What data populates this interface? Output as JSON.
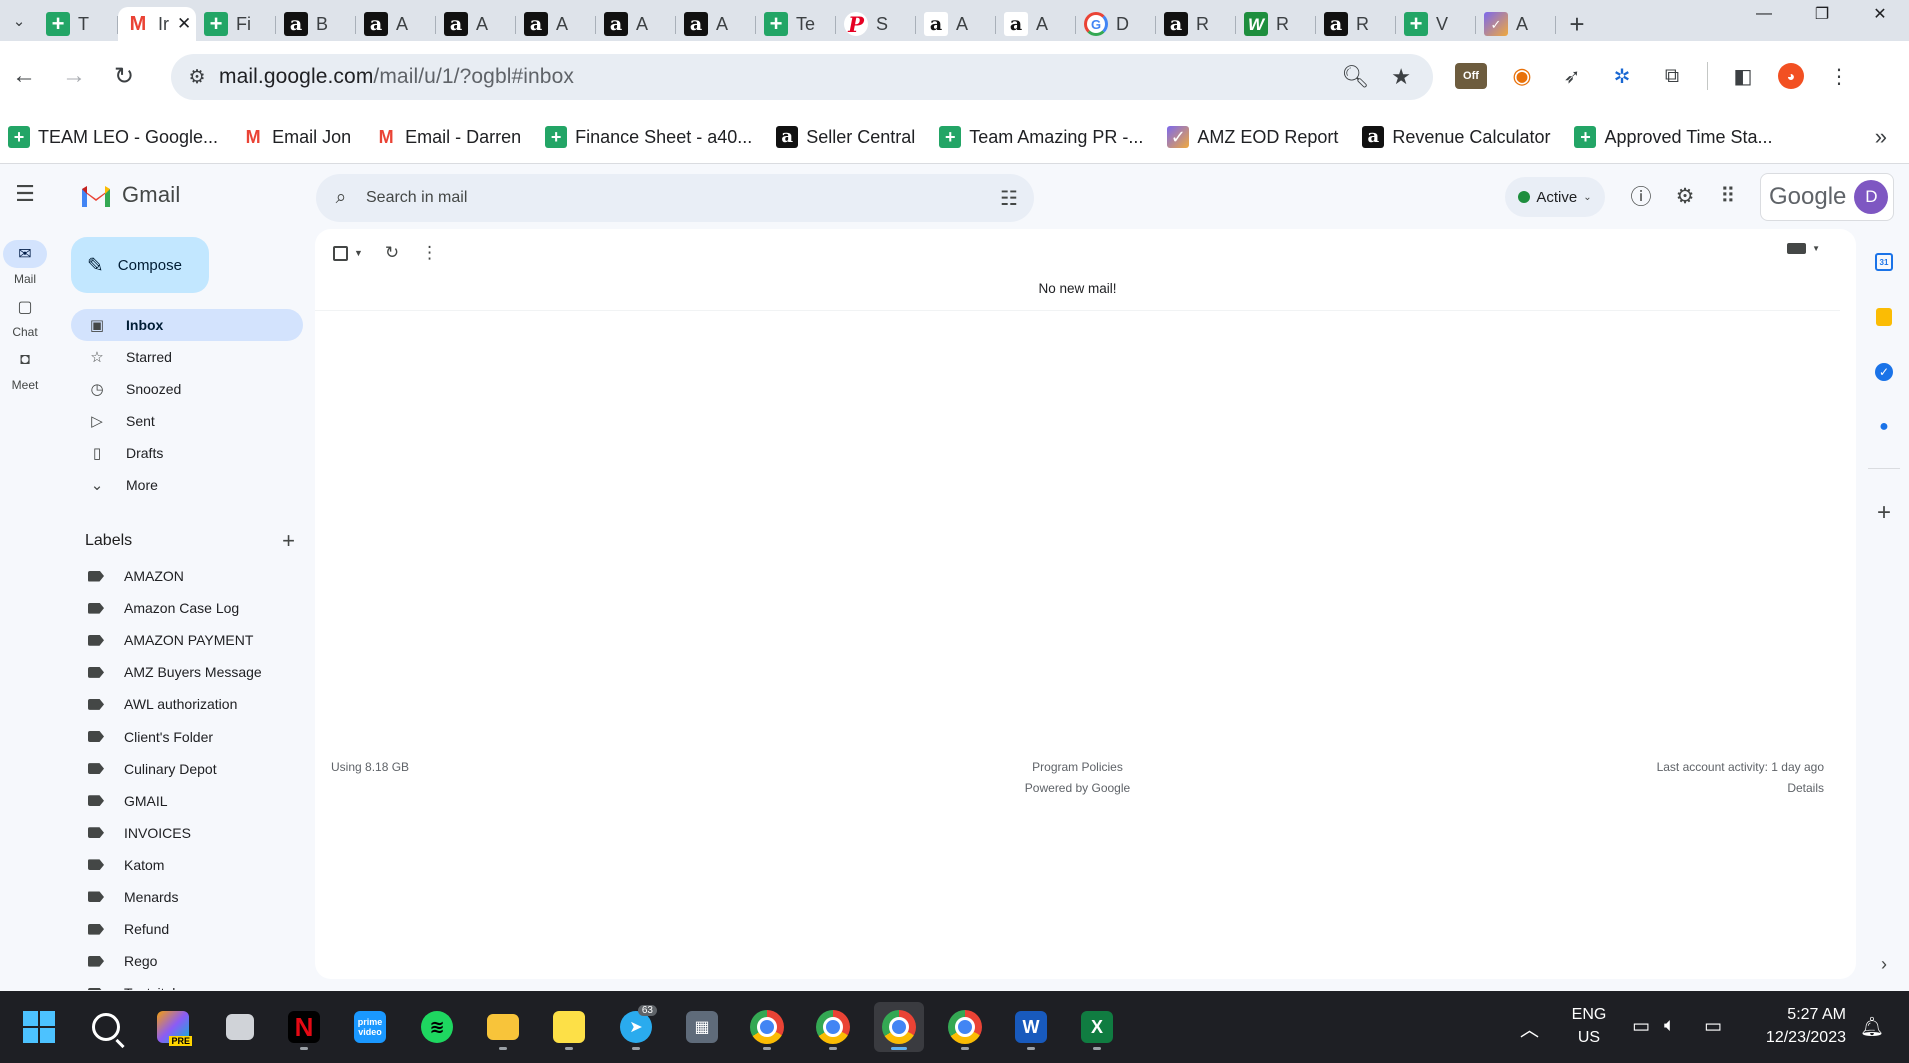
{
  "browser": {
    "tabs": [
      {
        "label": "T",
        "icon": "sheets-icon",
        "active": false
      },
      {
        "label": "Ir",
        "icon": "gmail-icon",
        "active": true
      },
      {
        "label": "Fi",
        "icon": "sheets-icon",
        "active": false
      },
      {
        "label": "B",
        "icon": "amazon-icon",
        "active": false
      },
      {
        "label": "A",
        "icon": "amazon-icon",
        "active": false
      },
      {
        "label": "A",
        "icon": "amazon-icon",
        "active": false
      },
      {
        "label": "A",
        "icon": "amazon-icon",
        "active": false
      },
      {
        "label": "A",
        "icon": "amazon-icon",
        "active": false
      },
      {
        "label": "A",
        "icon": "amazon-icon",
        "active": false
      },
      {
        "label": "Te",
        "icon": "sheets-icon",
        "active": false
      },
      {
        "label": "S",
        "icon": "pinterest-icon",
        "active": false
      },
      {
        "label": "A",
        "icon": "amazon-white-icon",
        "active": false
      },
      {
        "label": "A",
        "icon": "amazon-white-icon",
        "active": false
      },
      {
        "label": "D",
        "icon": "google-icon",
        "active": false
      },
      {
        "label": "R",
        "icon": "amazon-icon",
        "active": false
      },
      {
        "label": "R",
        "icon": "w-icon",
        "active": false
      },
      {
        "label": "R",
        "icon": "amazon-icon",
        "active": false
      },
      {
        "label": "V",
        "icon": "sheets-icon",
        "active": false
      },
      {
        "label": "A",
        "icon": "clickup-icon",
        "active": false
      }
    ],
    "url_host": "mail.google.com",
    "url_path": "/mail/u/1/?ogbl#inbox",
    "extension_off_label": "Off",
    "bookmarks": [
      {
        "label": "TEAM LEO - Google...",
        "icon": "sheets-icon"
      },
      {
        "label": "Email Jon",
        "icon": "gmail-icon"
      },
      {
        "label": "Email - Darren",
        "icon": "gmail-icon"
      },
      {
        "label": "Finance Sheet - a40...",
        "icon": "sheets-icon"
      },
      {
        "label": "Seller Central",
        "icon": "amazon-icon"
      },
      {
        "label": "Team Amazing PR -...",
        "icon": "sheets-icon"
      },
      {
        "label": "AMZ EOD Report",
        "icon": "clickup-icon"
      },
      {
        "label": "Revenue Calculator",
        "icon": "amazon-icon"
      },
      {
        "label": "Approved Time Sta...",
        "icon": "sheets-icon"
      }
    ]
  },
  "gmail": {
    "app_name": "Gmail",
    "search_placeholder": "Search in mail",
    "status": "Active",
    "account_brand": "Google",
    "avatar_initial": "D",
    "rail": [
      {
        "label": "Mail",
        "icon": "mail-icon"
      },
      {
        "label": "Chat",
        "icon": "chat-icon"
      },
      {
        "label": "Meet",
        "icon": "meet-icon"
      }
    ],
    "compose_label": "Compose",
    "nav": [
      {
        "label": "Inbox",
        "icon": "inbox-icon",
        "symbol": "▣",
        "selected": true
      },
      {
        "label": "Starred",
        "icon": "star-icon",
        "symbol": "☆",
        "selected": false
      },
      {
        "label": "Snoozed",
        "icon": "clock-icon",
        "symbol": "◷",
        "selected": false
      },
      {
        "label": "Sent",
        "icon": "send-icon",
        "symbol": "▷",
        "selected": false
      },
      {
        "label": "Drafts",
        "icon": "draft-icon",
        "symbol": "▯",
        "selected": false
      },
      {
        "label": "More",
        "icon": "chevron-down-icon",
        "symbol": "⌄",
        "selected": false
      }
    ],
    "labels_title": "Labels",
    "labels": [
      "AMAZON",
      "Amazon Case Log",
      "AMAZON PAYMENT",
      "AMZ Buyers Message",
      "AWL authorization",
      "Client's Folder",
      "Culinary Depot",
      "GMAIL",
      "INVOICES",
      "Katom",
      "Menards",
      "Refund",
      "Rego",
      "Tootsitel"
    ],
    "empty_message": "No new mail!",
    "footer": {
      "storage": "Using 8.18 GB",
      "policies": "Program Policies",
      "powered": "Powered by Google",
      "activity": "Last account activity: 1 day ago",
      "details": "Details"
    }
  },
  "taskbar": {
    "language_line1": "ENG",
    "language_line2": "US",
    "time": "5:27 AM",
    "date": "12/23/2023",
    "telegram_badge": "63",
    "copilot_badge": "PRE",
    "prime_label": "prime video"
  }
}
